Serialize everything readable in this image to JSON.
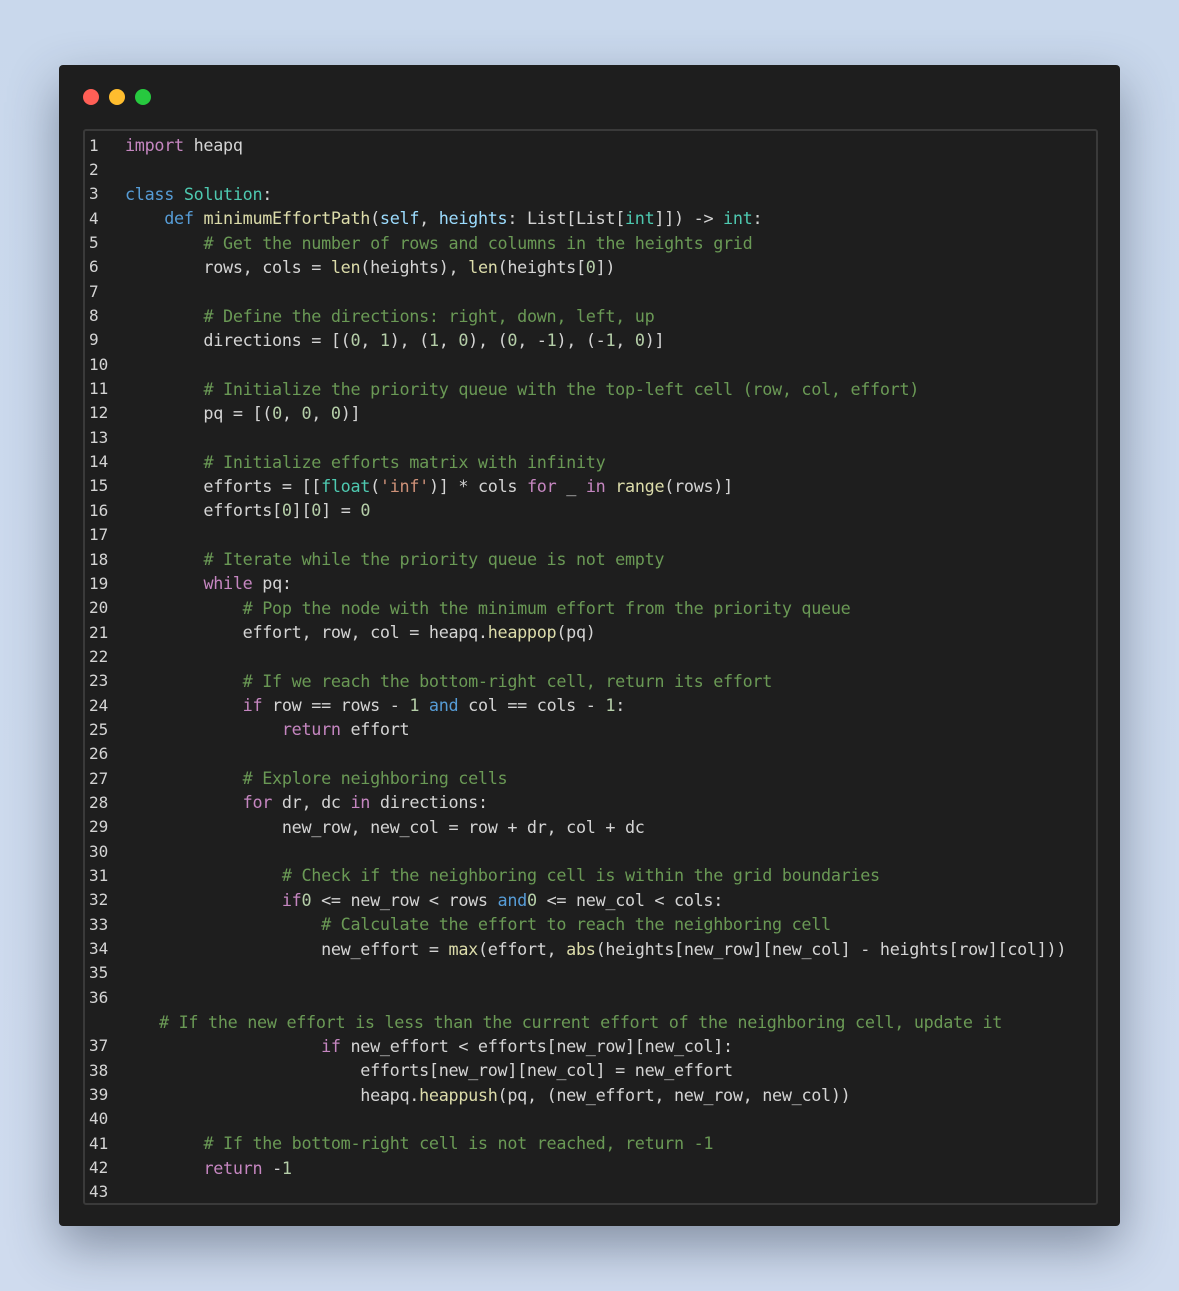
{
  "window": {
    "controls": [
      {
        "name": "close",
        "color": "#ff5f56"
      },
      {
        "name": "minimize",
        "color": "#ffbd2e"
      },
      {
        "name": "maximize",
        "color": "#27c93f"
      }
    ]
  },
  "editor": {
    "language": "python",
    "colors": {
      "background": "#1e1e1e",
      "keyword": "#c586c0",
      "builtin_keyword": "#569cd6",
      "class_name": "#4ec9b0",
      "function": "#dcdcaa",
      "comment": "#6a9955",
      "number": "#b5cea8",
      "string": "#ce9178",
      "text": "#d4d4d4"
    },
    "lines": [
      {
        "n": "1",
        "tokens": [
          [
            "kw",
            "import"
          ],
          [
            "",
            "heapq"
          ]
        ],
        "indent": 0,
        "join": " "
      },
      {
        "n": "2",
        "tokens": []
      },
      {
        "n": "3",
        "tokens": [
          [
            "kb",
            "class "
          ],
          [
            "cls",
            "Solution"
          ],
          [
            "",
            ":"
          ]
        ]
      },
      {
        "n": "4",
        "tokens": [
          [
            "",
            "    "
          ],
          [
            "kb",
            "def "
          ],
          [
            "fn",
            "minimumEffortPath"
          ],
          [
            "",
            "("
          ],
          [
            "var",
            "self"
          ],
          [
            "",
            ", "
          ],
          [
            "var",
            "heights"
          ],
          [
            "",
            ": List[List["
          ],
          [
            "cls",
            "int"
          ],
          [
            "",
            "]]) -> "
          ],
          [
            "cls",
            "int"
          ],
          [
            "",
            ":"
          ]
        ]
      },
      {
        "n": "5",
        "tokens": [
          [
            "",
            "        "
          ],
          [
            "cm",
            "# Get the number of rows and columns in the heights grid"
          ]
        ]
      },
      {
        "n": "6",
        "tokens": [
          [
            "",
            "        rows, cols = "
          ],
          [
            "fn",
            "len"
          ],
          [
            "",
            "(heights), "
          ],
          [
            "fn",
            "len"
          ],
          [
            "",
            "(heights["
          ],
          [
            "num",
            "0"
          ],
          [
            "",
            "])"
          ]
        ]
      },
      {
        "n": "7",
        "tokens": []
      },
      {
        "n": "8",
        "tokens": [
          [
            "",
            "        "
          ],
          [
            "cm",
            "# Define the directions: right, down, left, up"
          ]
        ]
      },
      {
        "n": "9",
        "tokens": [
          [
            "",
            "        directions = [("
          ],
          [
            "num",
            "0"
          ],
          [
            "",
            ", "
          ],
          [
            "num",
            "1"
          ],
          [
            "",
            "), ("
          ],
          [
            "num",
            "1"
          ],
          [
            "",
            ", "
          ],
          [
            "num",
            "0"
          ],
          [
            "",
            "), ("
          ],
          [
            "num",
            "0"
          ],
          [
            "",
            ", -"
          ],
          [
            "num",
            "1"
          ],
          [
            "",
            "), (-"
          ],
          [
            "num",
            "1"
          ],
          [
            "",
            ", "
          ],
          [
            "num",
            "0"
          ],
          [
            "",
            ")]"
          ]
        ]
      },
      {
        "n": "10",
        "tokens": []
      },
      {
        "n": "11",
        "tokens": [
          [
            "",
            "        "
          ],
          [
            "cm",
            "# Initialize the priority queue with the top-left cell (row, col, effort)"
          ]
        ]
      },
      {
        "n": "12",
        "tokens": [
          [
            "",
            "        pq = [("
          ],
          [
            "num",
            "0"
          ],
          [
            "",
            ", "
          ],
          [
            "num",
            "0"
          ],
          [
            "",
            ", "
          ],
          [
            "num",
            "0"
          ],
          [
            "",
            ")]"
          ]
        ]
      },
      {
        "n": "13",
        "tokens": []
      },
      {
        "n": "14",
        "tokens": [
          [
            "",
            "        "
          ],
          [
            "cm",
            "# Initialize efforts matrix with infinity"
          ]
        ]
      },
      {
        "n": "15",
        "tokens": [
          [
            "",
            "        efforts = [["
          ],
          [
            "cls",
            "float"
          ],
          [
            "",
            "("
          ],
          [
            "str",
            "'inf'"
          ],
          [
            "",
            ")] * cols "
          ],
          [
            "kw",
            "for"
          ],
          [
            "",
            " _ "
          ],
          [
            "kw",
            "in"
          ],
          [
            "",
            ""
          ],
          [
            "fn",
            " range"
          ],
          [
            "",
            "(rows)]"
          ]
        ]
      },
      {
        "n": "16",
        "tokens": [
          [
            "",
            "        efforts["
          ],
          [
            "num",
            "0"
          ],
          [
            "",
            "]["
          ],
          [
            "num",
            "0"
          ],
          [
            "",
            "] = "
          ],
          [
            "num",
            "0"
          ]
        ]
      },
      {
        "n": "17",
        "tokens": []
      },
      {
        "n": "18",
        "tokens": [
          [
            "",
            "        "
          ],
          [
            "cm",
            "# Iterate while the priority queue is not empty"
          ]
        ]
      },
      {
        "n": "19",
        "tokens": [
          [
            "",
            "        "
          ],
          [
            "kw",
            "while"
          ],
          [
            "",
            " pq:"
          ]
        ]
      },
      {
        "n": "20",
        "tokens": [
          [
            "",
            "            "
          ],
          [
            "cm",
            "# Pop the node with the minimum effort from the priority queue"
          ]
        ]
      },
      {
        "n": "21",
        "tokens": [
          [
            "",
            "            effort, row, col = heapq."
          ],
          [
            "fn",
            "heappop"
          ],
          [
            "",
            "(pq)"
          ]
        ]
      },
      {
        "n": "22",
        "tokens": []
      },
      {
        "n": "23",
        "tokens": [
          [
            "",
            "            "
          ],
          [
            "cm",
            "# If we reach the bottom-right cell, return its effort"
          ]
        ]
      },
      {
        "n": "24",
        "tokens": [
          [
            "",
            "            "
          ],
          [
            "kw",
            "if"
          ],
          [
            "",
            " row == rows - "
          ],
          [
            "num",
            "1"
          ],
          [
            "",
            ""
          ],
          [
            "kb",
            " and"
          ],
          [
            "",
            " col == cols - "
          ],
          [
            "num",
            "1"
          ],
          [
            "",
            ":"
          ]
        ]
      },
      {
        "n": "25",
        "tokens": [
          [
            "",
            "                "
          ],
          [
            "kw",
            "return"
          ],
          [
            "",
            " effort"
          ]
        ]
      },
      {
        "n": "26",
        "tokens": []
      },
      {
        "n": "27",
        "tokens": [
          [
            "",
            "            "
          ],
          [
            "cm",
            "# Explore neighboring cells"
          ]
        ]
      },
      {
        "n": "28",
        "tokens": [
          [
            "",
            "            "
          ],
          [
            "kw",
            "for"
          ],
          [
            "",
            " dr, dc "
          ],
          [
            "kw",
            "in"
          ],
          [
            "",
            " directions:"
          ]
        ]
      },
      {
        "n": "29",
        "tokens": [
          [
            "",
            "                new_row, new_col = row + dr, col + dc"
          ]
        ]
      },
      {
        "n": "30",
        "tokens": []
      },
      {
        "n": "31",
        "tokens": [
          [
            "",
            "                "
          ],
          [
            "cm",
            "# Check if the neighboring cell is within the grid boundaries"
          ]
        ]
      },
      {
        "n": "32",
        "tokens": [
          [
            "",
            "                "
          ],
          [
            "kw",
            "if"
          ],
          [
            " ",
            ""
          ],
          [
            "num",
            "0"
          ],
          [
            "",
            " <= new_row < rows "
          ],
          [
            "kb",
            "and"
          ],
          [
            " ",
            ""
          ],
          [
            "num",
            "0"
          ],
          [
            "",
            " <= new_col < cols:"
          ]
        ]
      },
      {
        "n": "33",
        "tokens": [
          [
            "",
            "                    "
          ],
          [
            "cm",
            "# Calculate the effort to reach the neighboring cell"
          ]
        ]
      },
      {
        "n": "34",
        "tokens": [
          [
            "",
            "                    new_effort = "
          ],
          [
            "fn",
            "max"
          ],
          [
            "",
            "(effort, "
          ],
          [
            "fn",
            "abs"
          ],
          [
            "",
            "(heights[new_row][new_col] - heights[row][col]))"
          ]
        ]
      },
      {
        "n": "35",
        "tokens": []
      },
      {
        "n": "36",
        "tokens": []
      },
      {
        "n": "",
        "wrap": true,
        "tokens": [
          [
            "cm",
            "# If the new effort is less than the current effort of the neighboring cell, update it"
          ]
        ]
      },
      {
        "n": "37",
        "tokens": [
          [
            "",
            "                    "
          ],
          [
            "kw",
            "if"
          ],
          [
            "",
            " new_effort < efforts[new_row][new_col]:"
          ]
        ]
      },
      {
        "n": "38",
        "tokens": [
          [
            "",
            "                        efforts[new_row][new_col] = new_effort"
          ]
        ]
      },
      {
        "n": "39",
        "tokens": [
          [
            "",
            "                        heapq."
          ],
          [
            "fn",
            "heappush"
          ],
          [
            "",
            "(pq, (new_effort, new_row, new_col))"
          ]
        ]
      },
      {
        "n": "40",
        "tokens": []
      },
      {
        "n": "41",
        "tokens": [
          [
            "",
            "        "
          ],
          [
            "cm",
            "# If the bottom-right cell is not reached, return -1"
          ]
        ]
      },
      {
        "n": "42",
        "tokens": [
          [
            "",
            "        "
          ],
          [
            "kw",
            "return"
          ],
          [
            "",
            " -"
          ],
          [
            "num",
            "1"
          ]
        ]
      },
      {
        "n": "43",
        "tokens": []
      }
    ]
  }
}
